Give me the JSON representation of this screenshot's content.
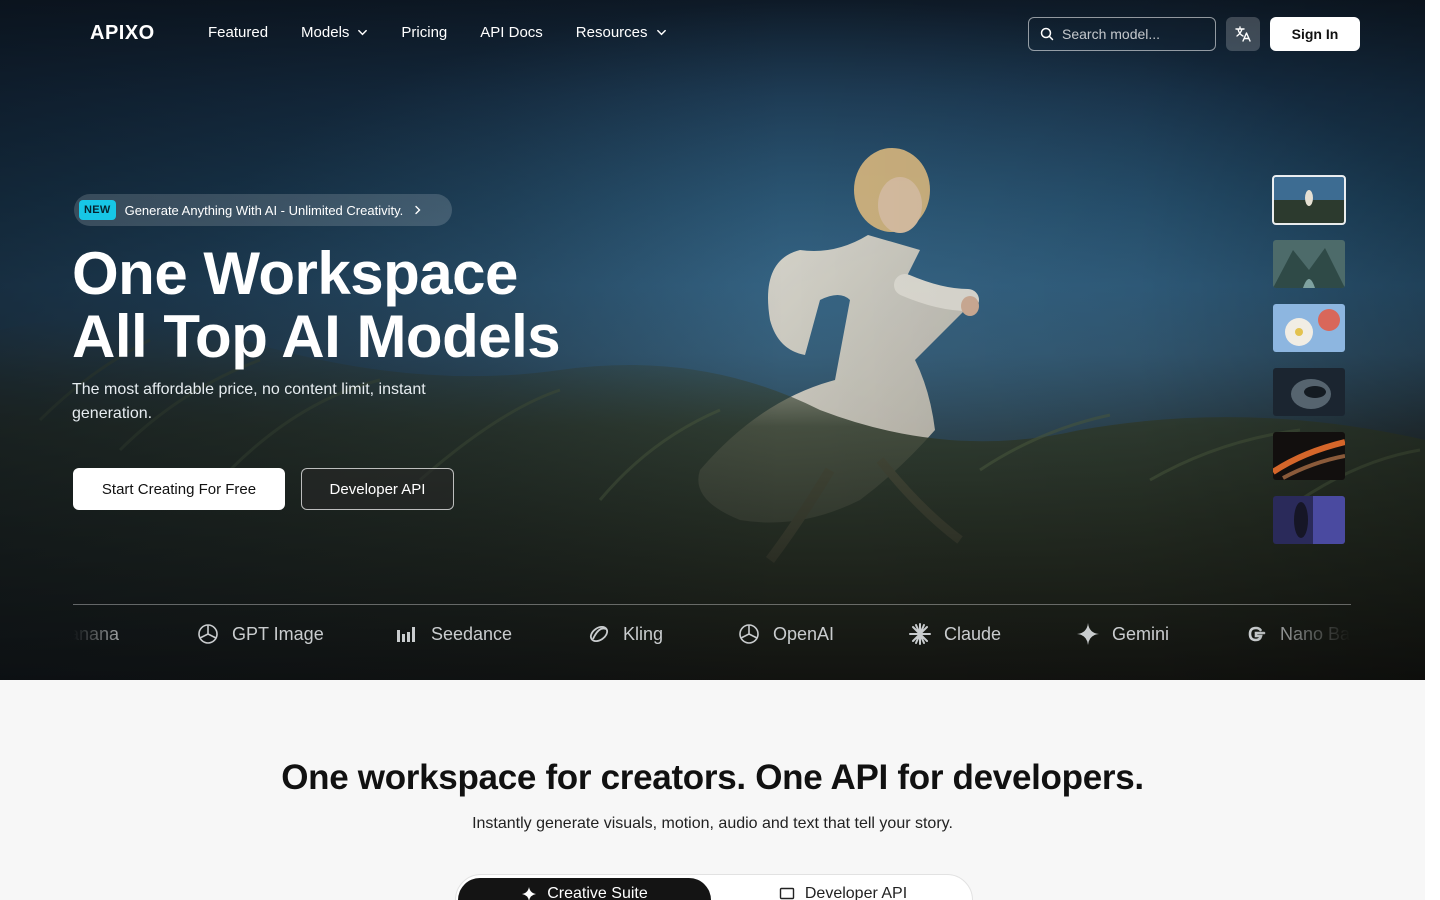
{
  "nav": {
    "logo": "APIXO",
    "links": [
      {
        "label": "Featured"
      },
      {
        "label": "Models"
      },
      {
        "label": "Pricing"
      },
      {
        "label": "API Docs"
      },
      {
        "label": "Resources"
      }
    ],
    "search_placeholder": "Search model...",
    "language_icon": "translate-icon",
    "signin_label": "Sign In"
  },
  "hero": {
    "badge_tag": "NEW",
    "badge_text": "Generate Anything With AI - Unlimited Creativity.",
    "headline_line1": "One Workspace",
    "headline_line2": "All Top AI Models",
    "subline": "The most affordable price, no content limit, instant generation.",
    "primary_cta": "Start Creating For Free",
    "secondary_cta": "Developer API",
    "thumbnail_count": 6,
    "active_thumbnail": 1
  },
  "models": [
    {
      "label": "anana",
      "icon": "banana-icon"
    },
    {
      "label": "GPT Image",
      "icon": "openai-icon"
    },
    {
      "label": "Seedance",
      "icon": "bars-icon"
    },
    {
      "label": "Kling",
      "icon": "kling-icon"
    },
    {
      "label": "OpenAI",
      "icon": "openai-icon"
    },
    {
      "label": "Claude",
      "icon": "claude-icon"
    },
    {
      "label": "Gemini",
      "icon": "gemini-icon"
    },
    {
      "label": "Nano Ba",
      "icon": "google-icon"
    }
  ],
  "section": {
    "title": "One workspace for creators. One API for developers.",
    "subtitle": "Instantly generate visuals, motion, audio and text that tell your story.",
    "tabs": [
      {
        "label": "Creative Suite",
        "active": true
      },
      {
        "label": "Developer API",
        "active": false
      }
    ]
  },
  "colors": {
    "badge_accent": "#17c6e6",
    "hero_dark": "#111210",
    "sky": "#2a5676",
    "page_bg": "#f7f7f7"
  }
}
